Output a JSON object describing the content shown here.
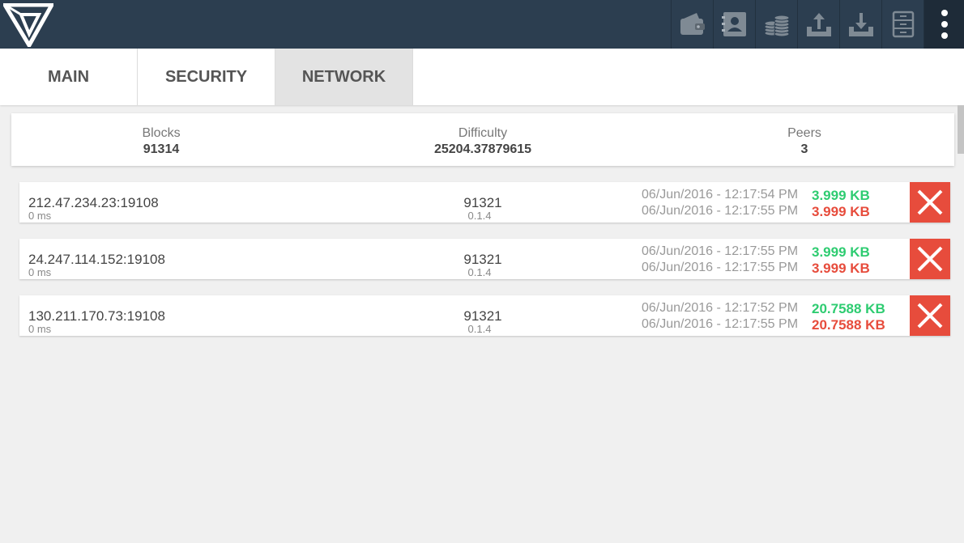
{
  "app": {
    "logo_icon": "v-logo-icon",
    "colors": {
      "topbar": "#2c3e50",
      "accent_green": "#2ecc71",
      "accent_red": "#e74c3c",
      "active_tab": "#e3e3e3"
    }
  },
  "toolbar": {
    "buttons": [
      {
        "icon": "wallet-icon"
      },
      {
        "icon": "address-book-icon"
      },
      {
        "icon": "coins-icon"
      },
      {
        "icon": "send-upload-icon"
      },
      {
        "icon": "receive-download-icon"
      },
      {
        "icon": "storage-cabinet-icon"
      }
    ],
    "menu_icon": "more-vertical-icon"
  },
  "tabs": [
    {
      "label": "MAIN",
      "active": false
    },
    {
      "label": "SECURITY",
      "active": false
    },
    {
      "label": "NETWORK",
      "active": true
    }
  ],
  "stats": {
    "blocks": {
      "label": "Blocks",
      "value": "91314"
    },
    "difficulty": {
      "label": "Difficulty",
      "value": "25204.37879615"
    },
    "peers": {
      "label": "Peers",
      "value": "3"
    }
  },
  "peers": [
    {
      "address": "212.47.234.23:19108",
      "ping": "0 ms",
      "height": "91321",
      "version": "0.1.4",
      "time_sent": "06/Jun/2016 - 12:17:54 PM",
      "time_recv": "06/Jun/2016 - 12:17:55 PM",
      "bytes_sent": "3.999 KB",
      "bytes_recv": "3.999 KB",
      "remove_icon": "close-icon"
    },
    {
      "address": "24.247.114.152:19108",
      "ping": "0 ms",
      "height": "91321",
      "version": "0.1.4",
      "time_sent": "06/Jun/2016 - 12:17:55 PM",
      "time_recv": "06/Jun/2016 - 12:17:55 PM",
      "bytes_sent": "3.999 KB",
      "bytes_recv": "3.999 KB",
      "remove_icon": "close-icon"
    },
    {
      "address": "130.211.170.73:19108",
      "ping": "0 ms",
      "height": "91321",
      "version": "0.1.4",
      "time_sent": "06/Jun/2016 - 12:17:52 PM",
      "time_recv": "06/Jun/2016 - 12:17:55 PM",
      "bytes_sent": "20.7588 KB",
      "bytes_recv": "20.7588 KB",
      "remove_icon": "close-icon"
    }
  ]
}
